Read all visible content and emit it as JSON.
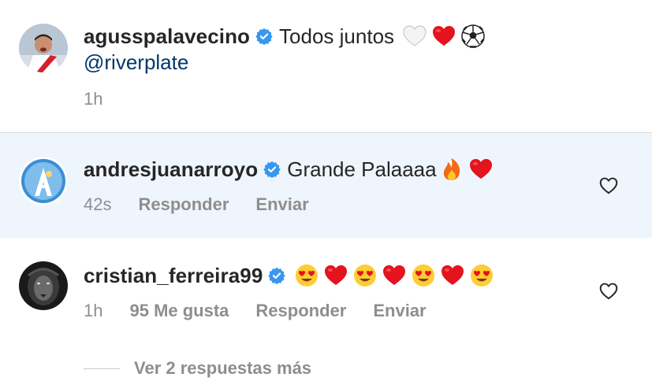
{
  "comments": [
    {
      "username": "agusspalavecino",
      "verified": true,
      "text": "Todos juntos",
      "emojis": [
        "white-heart",
        "red-heart",
        "soccer-ball"
      ],
      "mention": "@riverplate",
      "time": "1h"
    },
    {
      "username": "andresjuanarroyo",
      "verified": true,
      "text": "Grande Palaaaa",
      "emojis": [
        "fire",
        "red-heart"
      ],
      "time": "42s",
      "reply_label": "Responder",
      "send_label": "Enviar",
      "highlighted": true
    },
    {
      "username": "cristian_ferreira99",
      "verified": true,
      "emojis": [
        "heart-eyes",
        "red-heart",
        "heart-eyes",
        "red-heart",
        "heart-eyes",
        "red-heart",
        "heart-eyes"
      ],
      "time": "1h",
      "likes": "95 Me gusta",
      "reply_label": "Responder",
      "send_label": "Enviar",
      "view_replies": "Ver 2 respuestas más"
    }
  ],
  "colors": {
    "text": "#262626",
    "secondary": "#8e8e8e",
    "mention": "#00376b",
    "verified": "#3897f0",
    "highlight_bg": "#eff5fd"
  }
}
